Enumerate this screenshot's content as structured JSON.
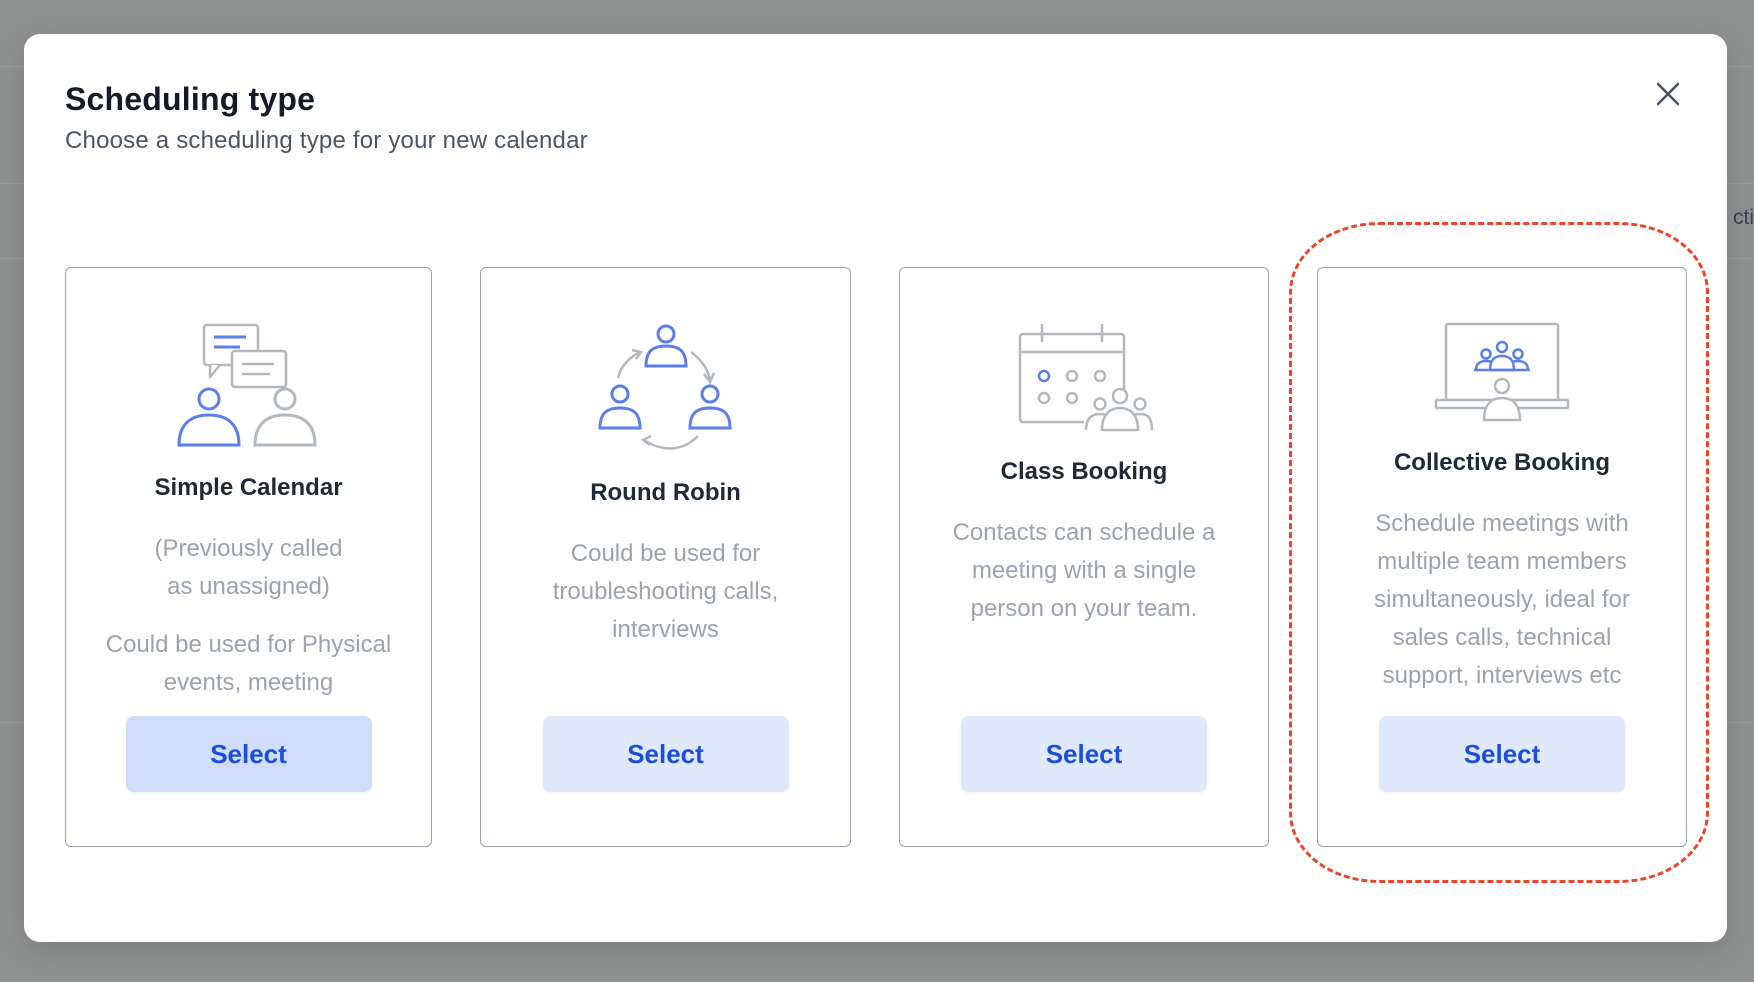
{
  "background": {
    "partial_text": "cti"
  },
  "modal": {
    "title": "Scheduling type",
    "subtitle": "Choose a scheduling type for your new calendar",
    "close_icon": "close-icon"
  },
  "cards": [
    {
      "icon": "chat-people-icon",
      "title": "Simple Calendar",
      "desc1_line1": "(Previously called",
      "desc1_line2": "as unassigned)",
      "desc2_line1": "Could be used for Physical",
      "desc2_line2": "events, meeting",
      "button": "Select"
    },
    {
      "icon": "round-robin-icon",
      "title": "Round Robin",
      "desc_line1": "Could be used for",
      "desc_line2": "troubleshooting calls,",
      "desc_line3": "interviews",
      "button": "Select"
    },
    {
      "icon": "calendar-group-icon",
      "title": "Class Booking",
      "desc_line1": "Contacts can schedule a",
      "desc_line2": "meeting with a single",
      "desc_line3": "person on your team.",
      "button": "Select"
    },
    {
      "icon": "presentation-group-icon",
      "title": "Collective Booking",
      "desc_line1": "Schedule meetings with",
      "desc_line2": "multiple team members",
      "desc_line3": "simultaneously, ideal for",
      "desc_line4": "sales calls, technical",
      "desc_line5": "support, interviews etc",
      "button": "Select"
    }
  ],
  "colors": {
    "accent": "#1d4ed8",
    "icon_blue": "#5b7ee8",
    "icon_gray": "#b3b8bf",
    "highlight": "#e8452c"
  }
}
